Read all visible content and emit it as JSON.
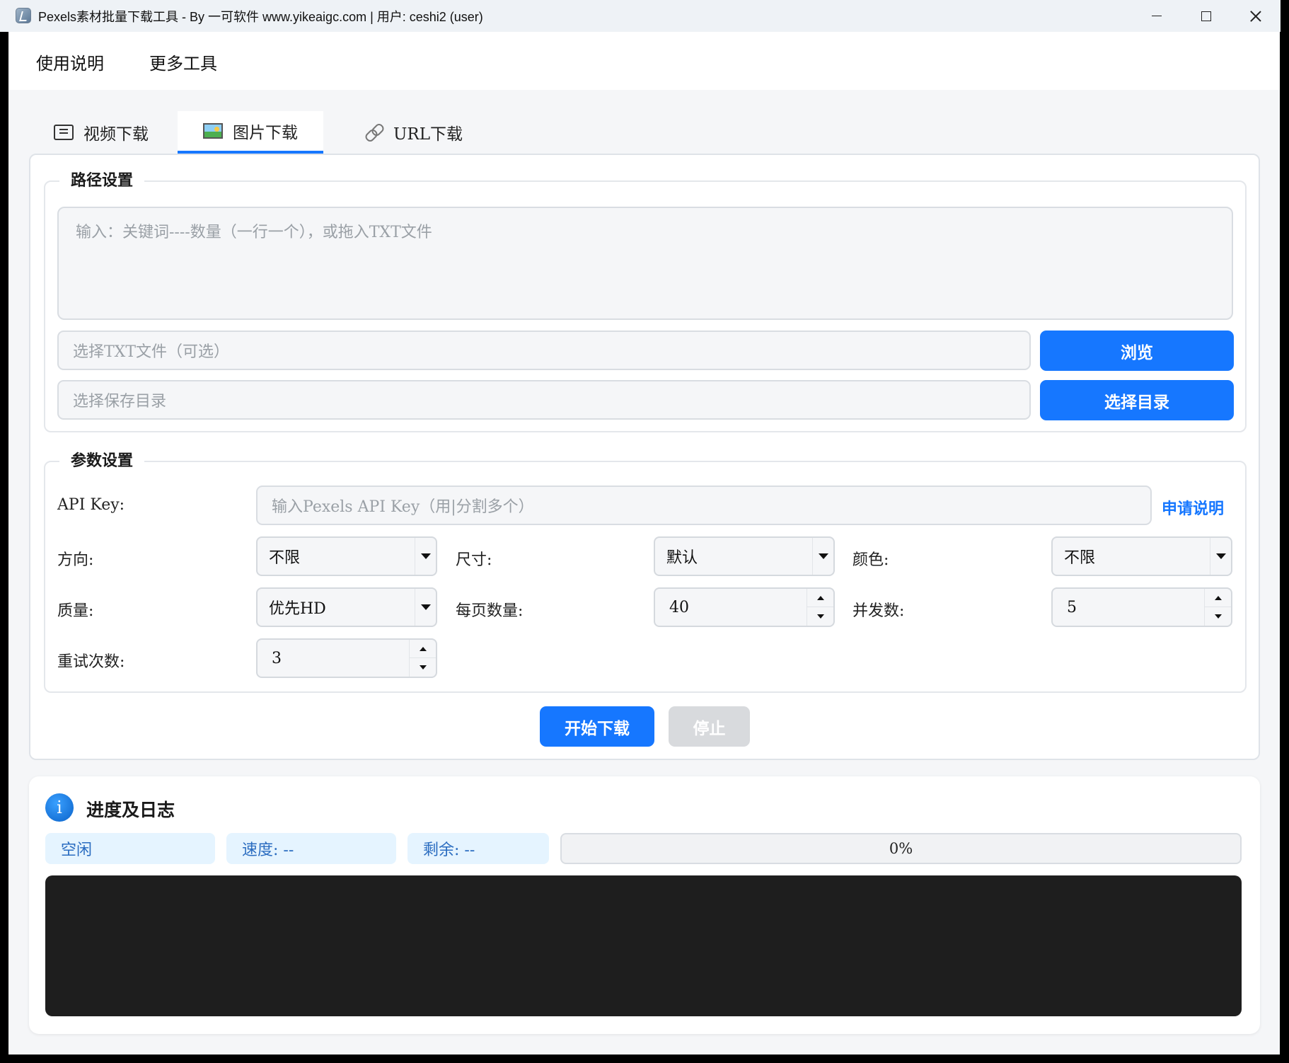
{
  "window": {
    "title": "Pexels素材批量下载工具 - By 一可软件 www.yikeaigc.com | 用户: ceshi2 (user)"
  },
  "menu": {
    "help": "使用说明",
    "tools": "更多工具"
  },
  "tabs": [
    {
      "label": "视频下载",
      "icon": "video-icon",
      "active": false
    },
    {
      "label": "图片下载",
      "icon": "image-icon",
      "active": true
    },
    {
      "label": "URL下载",
      "icon": "link-icon",
      "active": false
    }
  ],
  "path_settings": {
    "title": "路径设置",
    "keywords_placeholder": "输入：关键词----数量（一行一个），或拖入TXT文件",
    "txt_file_placeholder": "选择TXT文件（可选）",
    "browse_label": "浏览",
    "save_dir_placeholder": "选择保存目录",
    "choose_dir_label": "选择目录"
  },
  "param_settings": {
    "title": "参数设置",
    "api_key_label": "API Key:",
    "api_key_placeholder": "输入Pexels API Key（用|分割多个）",
    "apply_link": "申请说明",
    "orientation_label": "方向:",
    "orientation_value": "不限",
    "size_label": "尺寸:",
    "size_value": "默认",
    "color_label": "颜色:",
    "color_value": "不限",
    "quality_label": "质量:",
    "quality_value": "优先HD",
    "per_page_label": "每页数量:",
    "per_page_value": "40",
    "concurrency_label": "并发数:",
    "concurrency_value": "5",
    "retry_label": "重试次数:",
    "retry_value": "3"
  },
  "actions": {
    "start_label": "开始下载",
    "stop_label": "停止"
  },
  "log": {
    "title": "进度及日志",
    "status": "空闲",
    "speed": "速度: --",
    "remaining": "剩余: --",
    "progress_text": "0%",
    "progress_fraction": 0
  },
  "colors": {
    "accent": "#1677ff",
    "console_bg": "#1e1e1e",
    "stat_bg": "#e5f4ff"
  }
}
